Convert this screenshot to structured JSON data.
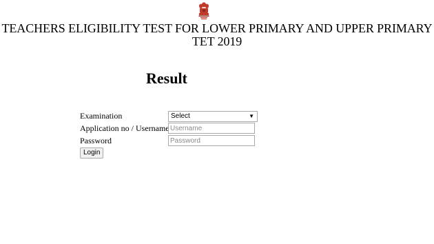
{
  "header": {
    "emblem_icon": "national-emblem-icon",
    "title_line1": "TEACHERS ELIGIBILITY TEST FOR LOWER PRIMARY AND UPPER PRIMARY",
    "title_line2": "TET 2019"
  },
  "main": {
    "title": "Result",
    "form": {
      "examination_label": "Examination",
      "examination_selected": "Select",
      "username_label": "Application no / Username",
      "username_placeholder": "Username",
      "password_label": "Password",
      "password_placeholder": "Password",
      "login_label": "Login"
    }
  },
  "colors": {
    "emblem": "#c0392b",
    "emblem_dark": "#8e2a20",
    "input_border": "#a9a9a9",
    "button_bg": "#f0f0f0"
  }
}
